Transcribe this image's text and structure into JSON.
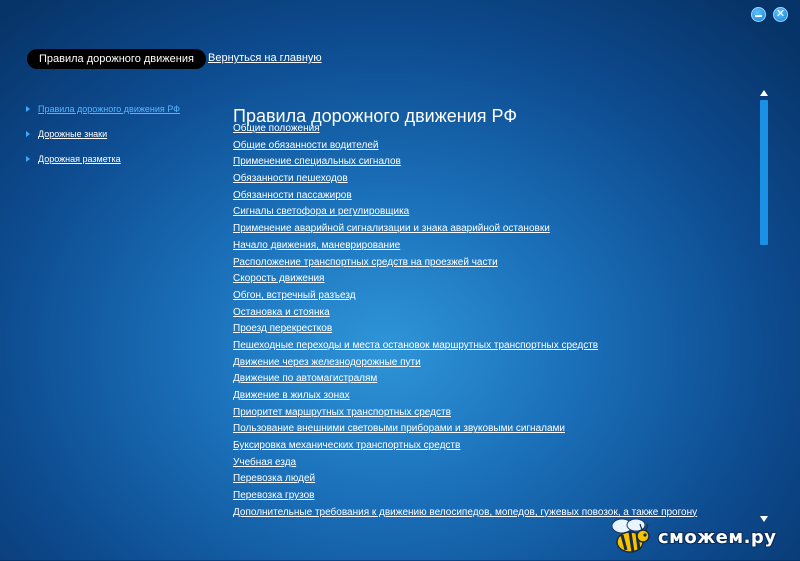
{
  "window": {
    "minimize_glyph": "–",
    "close_glyph": "✕"
  },
  "header": {
    "active_tab": "Правила дорожного движения",
    "home_link": "Вернуться на главную"
  },
  "sidebar": {
    "items": [
      {
        "label": "Правила дорожного движения РФ",
        "active": true
      },
      {
        "label": "Дорожные знаки",
        "active": false
      },
      {
        "label": "Дорожная разметка",
        "active": false
      }
    ]
  },
  "main": {
    "title": "Правила дорожного движения РФ",
    "items": [
      "Общие положения",
      "Общие обязанности водителей",
      "Применение специальных сигналов",
      "Обязанности пешеходов",
      "Обязанности пассажиров",
      "Сигналы светофора и регулировщика",
      "Применение аварийной сигнализации и знака аварийной остановки",
      "Начало движения, маневрирование",
      "Расположение транспортных средств на проезжей части",
      "Скорость движения",
      "Обгон, встречный разъезд",
      "Остановка и стоянка",
      "Проезд перекрестков",
      "Пешеходные переходы и места остановок маршрутных транспортных средств",
      "Движение через железнодорожные пути",
      "Движение по автомагистралям",
      "Движение в жилых зонах",
      "Приоритет маршрутных транспортных средств",
      "Пользование внешними световыми приборами и звуковыми сигналами",
      "Буксировка механических транспортных средств",
      "Учебная езда",
      "Перевозка людей",
      "Перевозка грузов",
      "Дополнительные требования к движению велосипедов, мопедов, гужевых повозок, а также прогону"
    ]
  },
  "scrollbar": {
    "position_fraction": 0
  },
  "watermark": {
    "text": "сможем.ру"
  },
  "colors": {
    "background": "#1a6fb8",
    "accent": "#1b91e6",
    "active_link": "#56b4ff",
    "tab_bg": "#000000"
  }
}
